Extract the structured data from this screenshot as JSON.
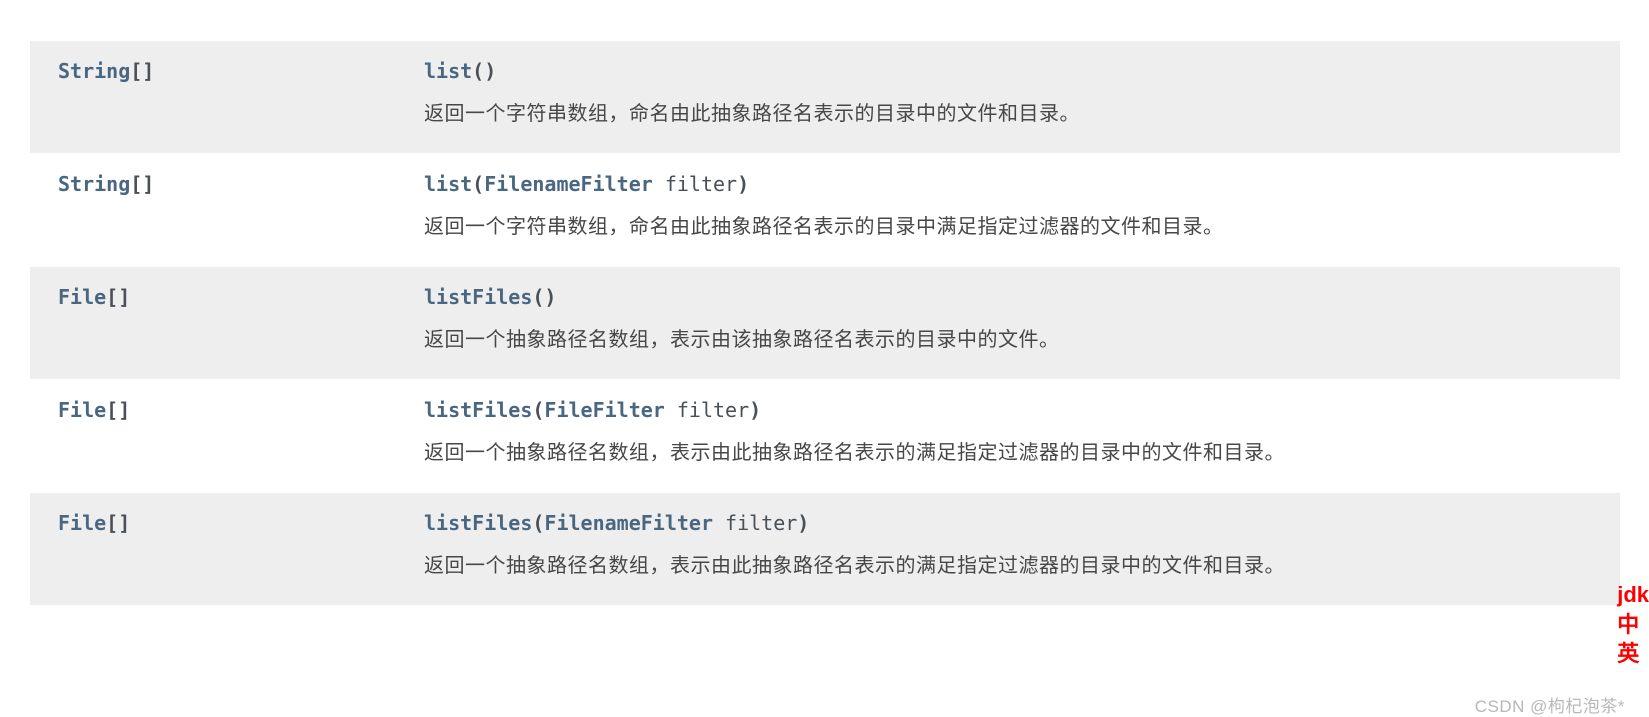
{
  "rows": [
    {
      "bg": "row-alt",
      "return_type": "String",
      "return_suffix": "[]",
      "method": "list",
      "paren_open": "(",
      "param_type": "",
      "param_name": "",
      "paren_close": ")",
      "description": "返回一个字符串数组，命名由此抽象路径名表示的目录中的文件和目录。"
    },
    {
      "bg": "row-white",
      "return_type": "String",
      "return_suffix": "[]",
      "method": "list",
      "paren_open": "(",
      "param_type": "FilenameFilter",
      "param_name": " filter",
      "paren_close": ")",
      "description": "返回一个字符串数组，命名由此抽象路径名表示的目录中满足指定过滤器的文件和目录。"
    },
    {
      "bg": "row-alt",
      "return_type": "File",
      "return_suffix": "[]",
      "method": "listFiles",
      "paren_open": "(",
      "param_type": "",
      "param_name": "",
      "paren_close": ")",
      "description": "返回一个抽象路径名数组，表示由该抽象路径名表示的目录中的文件。"
    },
    {
      "bg": "row-white",
      "return_type": "File",
      "return_suffix": "[]",
      "method": "listFiles",
      "paren_open": "(",
      "param_type": "FileFilter",
      "param_name": " filter",
      "paren_close": ")",
      "description": "返回一个抽象路径名数组，表示由此抽象路径名表示的满足指定过滤器的目录中的文件和目录。"
    },
    {
      "bg": "row-alt",
      "return_type": "File",
      "return_suffix": "[]",
      "method": "listFiles",
      "paren_open": "(",
      "param_type": "FilenameFilter",
      "param_name": " filter",
      "paren_close": ")",
      "description": "返回一个抽象路径名数组，表示由此抽象路径名表示的满足指定过滤器的目录中的文件和目录。"
    }
  ],
  "sidebar": {
    "line1": "jdk",
    "line2": "中",
    "line3": "英"
  },
  "watermark": "CSDN @枸杞泡茶*"
}
